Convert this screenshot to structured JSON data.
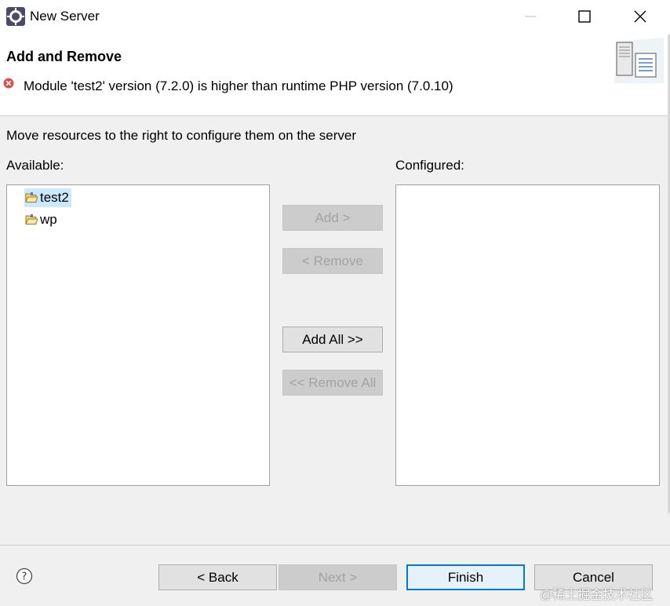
{
  "window": {
    "title": "New Server",
    "minimize_icon": "minimize-icon",
    "maximize_icon": "maximize-icon",
    "close_icon": "close-icon"
  },
  "header": {
    "title": "Add and Remove",
    "error_icon": "error-icon",
    "error_message": "Module 'test2' version (7.2.0) is higher than runtime PHP version (7.0.10)",
    "banner_icon": "server-wizard-icon"
  },
  "main": {
    "instructions": "Move resources to the right to configure them on the server",
    "available_label": "Available:",
    "configured_label": "Configured:",
    "available_items": [
      {
        "label": "test2",
        "icon": "project-folder-icon",
        "selected": true
      },
      {
        "label": "wp",
        "icon": "project-folder-icon",
        "selected": false
      }
    ],
    "configured_items": []
  },
  "buttons": {
    "add": "Add >",
    "remove": "< Remove",
    "add_all": "Add All >>",
    "remove_all": "<< Remove All"
  },
  "footer": {
    "help_icon": "help-icon",
    "back": "< Back",
    "next": "Next >",
    "finish": "Finish",
    "cancel": "Cancel"
  },
  "watermark": "@稀土掘金技术社区",
  "colors": {
    "selection": "#cce8ff",
    "default_button_border": "#0078d7",
    "error": "#d9534f"
  }
}
